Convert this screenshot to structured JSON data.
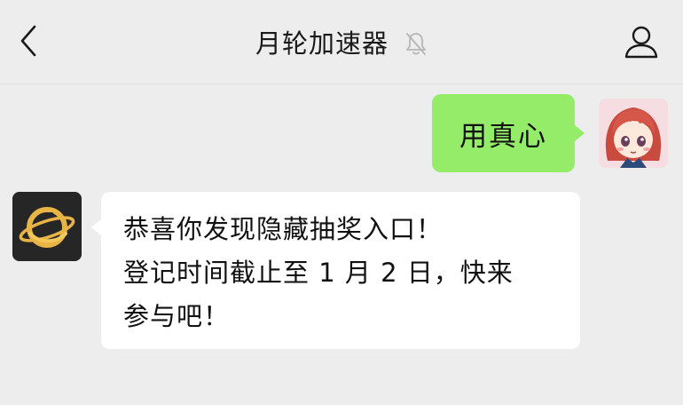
{
  "header": {
    "title": "月轮加速器"
  },
  "icons": {
    "back": "chevron-left-icon",
    "mute": "bell-slash-icon",
    "profile": "person-icon"
  },
  "messages": {
    "outgoing": {
      "text": "用真心"
    },
    "incoming": {
      "lines": [
        "恭喜你发现隐藏抽奖入口！",
        "登记时间截止至 1 月 2 日，快来",
        "参与吧！"
      ]
    }
  },
  "colors": {
    "background": "#ededed",
    "outgoing_bubble": "#95ec69",
    "incoming_bubble": "#ffffff",
    "bot_avatar_bg": "#262626",
    "bot_avatar_accent": "#e8b446"
  }
}
